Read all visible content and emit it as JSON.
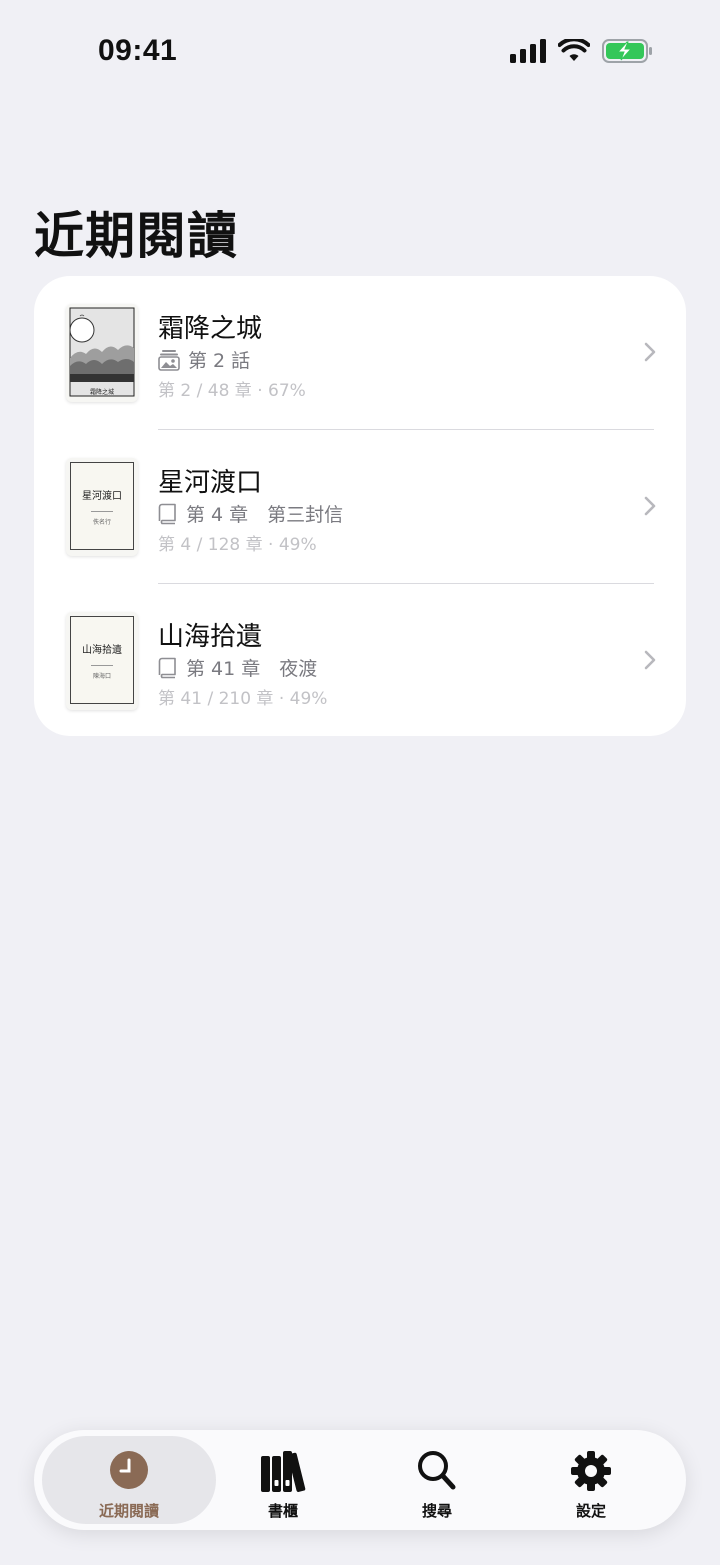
{
  "status_bar": {
    "time": "09:41",
    "battery_color": "#34C759"
  },
  "page": {
    "title": "近期閱讀"
  },
  "recent_items": [
    {
      "title": "霜降之城",
      "subtitle_icon": "image-icon",
      "subtitle": "第 2 話",
      "progress": "第 2 / 48 章 · 67%",
      "cover": {
        "type": "illustrated",
        "caption": "霜降之城"
      }
    },
    {
      "title": "星河渡口",
      "subtitle_icon": "book-icon",
      "subtitle": "第 4 章　第三封信",
      "progress": "第 4 / 128 章 · 49%",
      "cover": {
        "type": "text",
        "title": "星河渡口",
        "author": "佚名行"
      }
    },
    {
      "title": "山海拾遺",
      "subtitle_icon": "book-icon",
      "subtitle": "第 41 章　夜渡",
      "progress": "第 41 / 210 章 · 49%",
      "cover": {
        "type": "text",
        "title": "山海拾遺",
        "author": "陳海口"
      }
    }
  ],
  "tab_bar": {
    "accent_color": "#8A6A55",
    "tabs": [
      {
        "label": "近期閱讀",
        "icon": "clock-icon",
        "selected": true
      },
      {
        "label": "書櫃",
        "icon": "bookshelf-icon",
        "selected": false
      },
      {
        "label": "搜尋",
        "icon": "search-icon",
        "selected": false
      },
      {
        "label": "設定",
        "icon": "gear-icon",
        "selected": false
      }
    ]
  }
}
